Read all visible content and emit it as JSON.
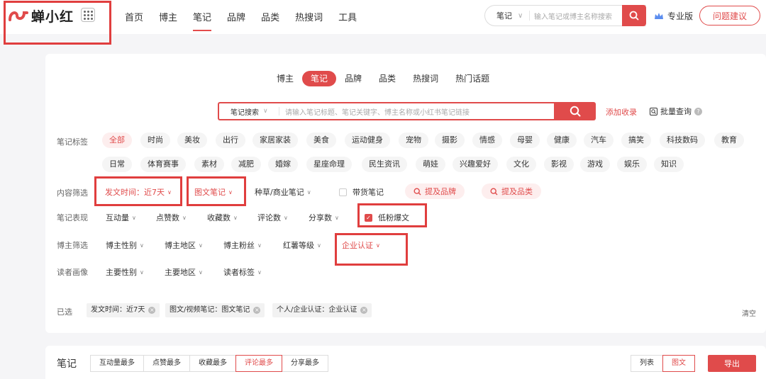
{
  "brand": {
    "name": "蝉小红",
    "accent": "#e04b4b"
  },
  "topnav": [
    {
      "label": "首页",
      "active": false
    },
    {
      "label": "博主",
      "active": false
    },
    {
      "label": "笔记",
      "active": true
    },
    {
      "label": "品牌",
      "active": false
    },
    {
      "label": "品类",
      "active": false
    },
    {
      "label": "热搜词",
      "active": false
    },
    {
      "label": "工具",
      "active": false
    }
  ],
  "top_search": {
    "type": "笔记",
    "placeholder": "输入笔记或博主名称搜索"
  },
  "pro_label": "专业版",
  "feedback_label": "问题建议",
  "tabs": [
    "博主",
    "笔记",
    "品牌",
    "品类",
    "热搜词",
    "热门话题"
  ],
  "active_tab": "笔记",
  "main_search": {
    "type": "笔记搜索",
    "placeholder": "请输入笔记标题、笔记关键字、博主名称或小红书笔记链接"
  },
  "add_record": "添加收录",
  "batch_query": "批量查询",
  "labels": {
    "tags": "笔记标签",
    "content": "内容筛选",
    "performance": "笔记表现",
    "blogger": "博主筛选",
    "reader": "读者画像",
    "selected": "已选"
  },
  "tags_row1": [
    "全部",
    "时尚",
    "美妆",
    "出行",
    "家居家装",
    "美食",
    "运动健身",
    "宠物",
    "摄影",
    "情感",
    "母婴",
    "健康",
    "汽车",
    "搞笑",
    "科技数码",
    "教育"
  ],
  "tags_row2": [
    "日常",
    "体育赛事",
    "素材",
    "减肥",
    "婚嫁",
    "星座命理",
    "民生资讯",
    "萌娃",
    "兴趣爱好",
    "文化",
    "影视",
    "游戏",
    "娱乐",
    "知识"
  ],
  "content_filters": {
    "time": "发文时间：近7天",
    "note_type": "图文笔记",
    "seeding": "种草/商业笔记",
    "goods": "带货笔记",
    "mention_brand": "提及品牌",
    "mention_category": "提及品类"
  },
  "performance_filters": [
    "互动量",
    "点赞数",
    "收藏数",
    "评论数",
    "分享数"
  ],
  "low_fans": "低粉爆文",
  "blogger_filters": [
    "博主性别",
    "博主地区",
    "博主粉丝",
    "红薯等级",
    "企业认证"
  ],
  "reader_filters": [
    "主要性别",
    "主要地区",
    "读者标签"
  ],
  "selected_chips": [
    "发文时间：近7天",
    "图文/视频笔记：图文笔记",
    "个人/企业认证：企业认证"
  ],
  "clear_label": "清空",
  "notes_title": "笔记",
  "sort_buttons": [
    "互动量最多",
    "点赞最多",
    "收藏最多",
    "评论最多",
    "分享最多"
  ],
  "active_sort": "评论最多",
  "view_buttons": [
    "列表",
    "图文"
  ],
  "active_view": "图文",
  "export_label": "导出"
}
